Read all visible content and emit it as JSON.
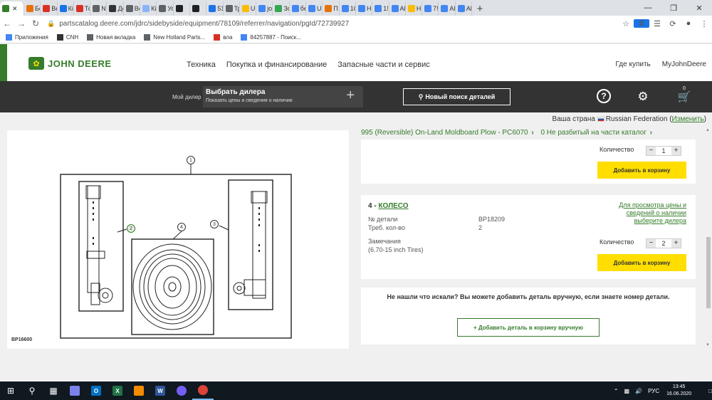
{
  "browser": {
    "tabs": [
      {
        "label": "",
        "active": true,
        "color": "#367c2b"
      },
      {
        "label": "Бе",
        "color": "#e8710a"
      },
      {
        "label": "Ве",
        "color": "#d93025"
      },
      {
        "label": "Кі",
        "color": "#1a73e8"
      },
      {
        "label": "Тс",
        "color": "#d93025"
      },
      {
        "label": "N",
        "color": "#5f6368"
      },
      {
        "label": "Де",
        "color": "#333333"
      },
      {
        "label": "Вс",
        "color": "#5f6368"
      },
      {
        "label": "Кі",
        "color": "#8ab4f8"
      },
      {
        "label": "Ус",
        "color": "#5f6368"
      },
      {
        "label": "",
        "color": "#202124"
      },
      {
        "label": "",
        "color": "#202124"
      },
      {
        "label": "51",
        "color": "#1a73e8"
      },
      {
        "label": "Тр",
        "color": "#5f6368"
      },
      {
        "label": "Ur",
        "color": "#fbbc04"
      },
      {
        "label": "jo",
        "color": "#4285f4"
      },
      {
        "label": "Зо",
        "color": "#34a853"
      },
      {
        "label": "бє",
        "color": "#4285f4"
      },
      {
        "label": "U",
        "color": "#4285f4"
      },
      {
        "label": "П",
        "color": "#e8710a"
      },
      {
        "label": "1C",
        "color": "#4285f4"
      },
      {
        "label": "Н",
        "color": "#4285f4"
      },
      {
        "label": "1!",
        "color": "#4285f4"
      },
      {
        "label": "Al",
        "color": "#4285f4"
      },
      {
        "label": "Н",
        "color": "#fbbc04"
      },
      {
        "label": "7!",
        "color": "#4285f4"
      },
      {
        "label": "Al",
        "color": "#4285f4"
      },
      {
        "label": "Al",
        "color": "#4285f4"
      }
    ],
    "new_tab": "+",
    "url": "partscatalog.deere.com/jdrc/sidebyside/equipment/78109/referrer/navigation/pgId/72739927",
    "bookmarks": [
      {
        "label": "Приложения",
        "color": "#4285f4"
      },
      {
        "label": "CNH",
        "color": "#333333"
      },
      {
        "label": "Новая вкладка",
        "color": "#5f6368"
      },
      {
        "label": "New Holland Parts...",
        "color": "#5f6368"
      },
      {
        "label": "вла",
        "color": "#d93025"
      },
      {
        "label": "84257887 - Поиск...",
        "color": "#4285f4"
      }
    ]
  },
  "header": {
    "logo_text": "JOHN DEERE",
    "nav": [
      "Техника",
      "Покупка и финансирование",
      "Запасные части и сервис"
    ],
    "right_nav": [
      "Где купить",
      "MyJohnDeere"
    ]
  },
  "dealer_bar": {
    "my_dealer": "Мой дилер",
    "select_title": "Выбрать дилера",
    "select_sub": "Показать цены и сведения о наличии",
    "plus": "+",
    "search_label": "Новый поиск деталей",
    "cart_count": "0"
  },
  "country": {
    "label": "Ваша страна",
    "name": "Russian Federation",
    "open": "(",
    "change": "Изменить",
    "close": ")"
  },
  "diagram": {
    "code": "BP16600",
    "callouts": [
      "1",
      "2",
      "3",
      "4"
    ]
  },
  "breadcrumb": {
    "item1": "995 (Reversible) On-Land Moldboard Plow - PC6070",
    "item2": "0 Не разбитый на части каталог"
  },
  "cards": {
    "prev_item": {
      "qty_label": "Количество",
      "qty_value": "1",
      "add_label": "Добавить в корзину"
    },
    "item4": {
      "number": "4 -",
      "name": "КОЛЕСО",
      "part_label": "№ детали",
      "part_value": "BP18209",
      "req_label": "Треб. кол-во",
      "req_value": "2",
      "notes_label": "Замечания",
      "notes_value": "(6.70-15 inch Tires)",
      "price_link": "Для просмотра цены и сведений о наличии выберите дилера",
      "qty_label": "Количество",
      "qty_value": "2",
      "add_label": "Добавить в корзину"
    },
    "manual": {
      "text": "Не нашли что искали? Вы можете добавить деталь вручную, если знаете номер детали.",
      "button": "+ Добавить деталь в корзину вручную"
    }
  },
  "taskbar": {
    "apps": [
      {
        "name": "save",
        "letter": "",
        "color": "#7b83eb"
      },
      {
        "name": "outlook",
        "letter": "O",
        "color": "#0072c6"
      },
      {
        "name": "excel",
        "letter": "X",
        "color": "#217346"
      },
      {
        "name": "vlc",
        "letter": "",
        "color": "#f48b00"
      },
      {
        "name": "word",
        "letter": "W",
        "color": "#2b579a"
      },
      {
        "name": "viber",
        "letter": "",
        "color": "#7360f2"
      },
      {
        "name": "chrome",
        "letter": "",
        "color": "#db4437"
      }
    ],
    "lang": "РУС",
    "time": "13:45",
    "date": "16.06.2020"
  }
}
